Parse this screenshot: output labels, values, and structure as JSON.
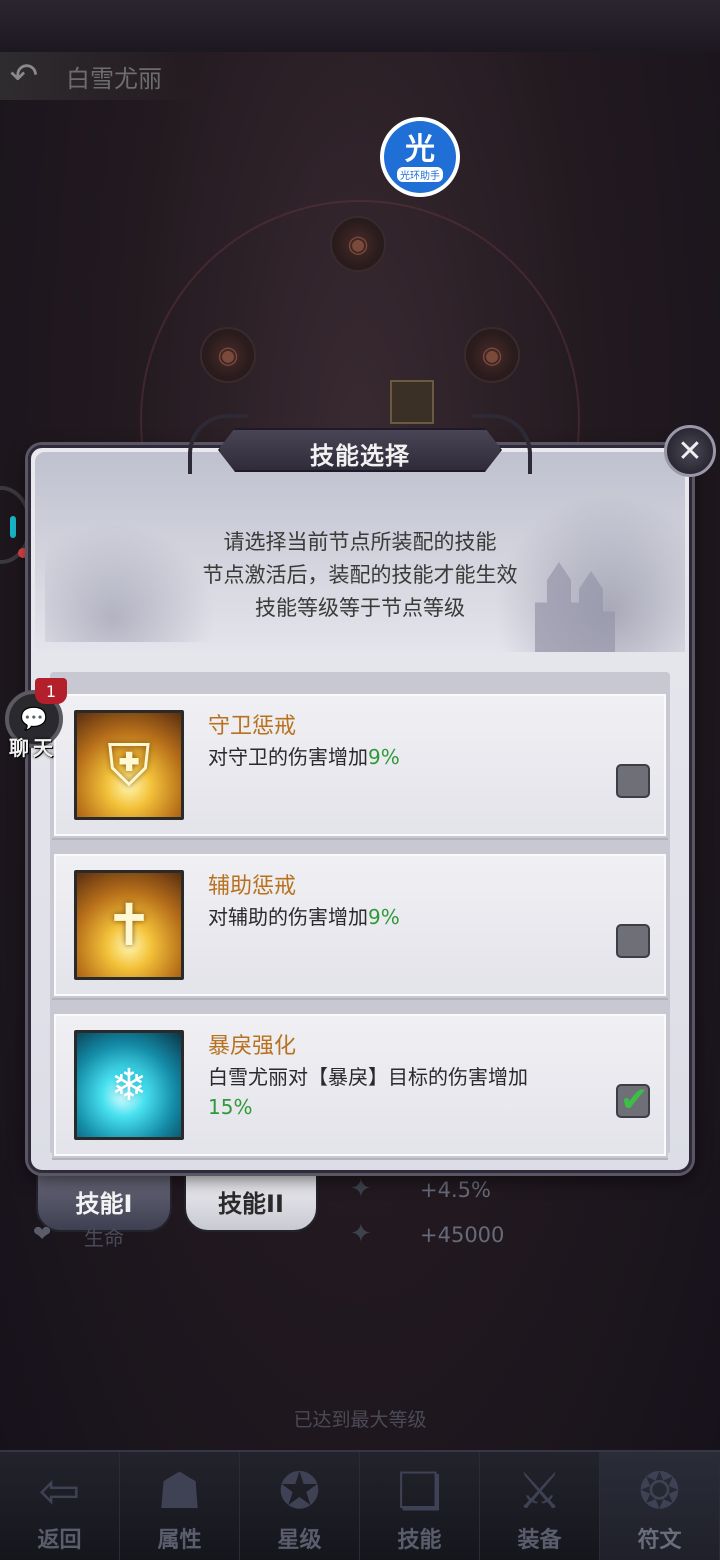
{
  "header": {
    "back_icon": "back-arrow-icon",
    "character_name": "白雪尤丽"
  },
  "watermark": {
    "big": "光",
    "small": "光环助手"
  },
  "dialog": {
    "title": "技能选择",
    "close_icon": "close-x-icon",
    "description": [
      "请选择当前节点所装配的技能",
      "节点激活后，装配的技能才能生效",
      "技能等级等于节点等级"
    ],
    "skills": [
      {
        "name": "守卫惩戒",
        "desc_prefix": "对守卫的伤害增加",
        "pct": "9%",
        "selected": false,
        "icon": "shield-icon"
      },
      {
        "name": "辅助惩戒",
        "desc_prefix": "对辅助的伤害增加",
        "pct": "9%",
        "selected": false,
        "icon": "cross-icon"
      },
      {
        "name": "暴戾强化",
        "desc_prefix": "白雪尤丽对【暴戾】目标的伤害增加",
        "pct": "15%",
        "selected": true,
        "icon": "snowflake-icon"
      }
    ]
  },
  "tabs": [
    {
      "label": "技能I"
    },
    {
      "label": "技能II"
    }
  ],
  "stats": {
    "value1": "+4.5%",
    "label2": "生命",
    "value2": "+45000"
  },
  "max_level_text": "已达到最大等级",
  "chat": {
    "badge": "1",
    "label": "聊天"
  },
  "bottom_nav": [
    {
      "label": "返回",
      "icon": "return-icon"
    },
    {
      "label": "属性",
      "icon": "hooded-figure-icon"
    },
    {
      "label": "星级",
      "icon": "star-badge-icon"
    },
    {
      "label": "技能",
      "icon": "scroll-icon"
    },
    {
      "label": "装备",
      "icon": "crossed-swords-icon"
    },
    {
      "label": "符文",
      "icon": "rune-icon"
    }
  ]
}
